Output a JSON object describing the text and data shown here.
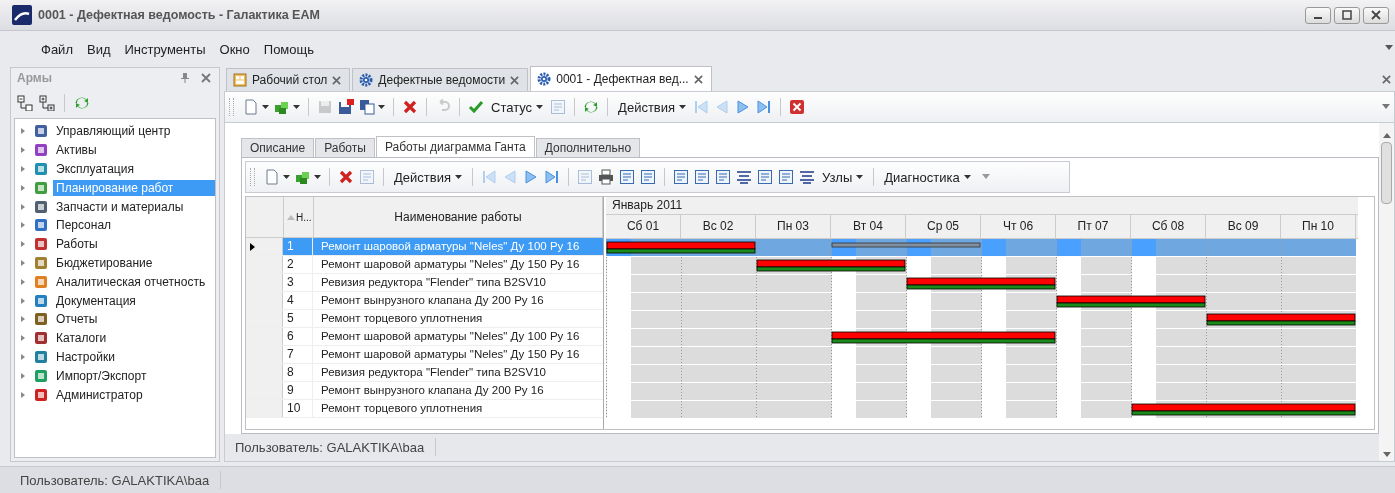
{
  "window": {
    "title": "0001 - Дефектная ведомость - Галактика EAM"
  },
  "menu": [
    "Файл",
    "Вид",
    "Инструменты",
    "Окно",
    "Помощь"
  ],
  "sidebar": {
    "title": "Армы",
    "items": [
      {
        "label": "Управляющий центр",
        "selected": false
      },
      {
        "label": "Активы",
        "selected": false
      },
      {
        "label": "Эксплуатация",
        "selected": false
      },
      {
        "label": "Планирование работ",
        "selected": true
      },
      {
        "label": "Запчасти и материалы",
        "selected": false
      },
      {
        "label": "Персонал",
        "selected": false
      },
      {
        "label": "Работы",
        "selected": false
      },
      {
        "label": "Бюджетирование",
        "selected": false
      },
      {
        "label": "Аналитическая отчетность",
        "selected": false
      },
      {
        "label": "Документация",
        "selected": false
      },
      {
        "label": "Отчеты",
        "selected": false
      },
      {
        "label": "Каталоги",
        "selected": false
      },
      {
        "label": "Настройки",
        "selected": false
      },
      {
        "label": "Импорт/Экспорт",
        "selected": false
      },
      {
        "label": "Администратор",
        "selected": false
      }
    ]
  },
  "doc_tabs": [
    {
      "label": "Рабочий стол",
      "selected": false
    },
    {
      "label": "Дефектные ведомости",
      "selected": false
    },
    {
      "label": "0001 - Дефектная вед...",
      "selected": true
    }
  ],
  "toolbar": {
    "menus": [
      "Статус",
      "Действия"
    ]
  },
  "form_tabs": [
    {
      "label": "Описание",
      "selected": false
    },
    {
      "label": "Работы",
      "selected": false
    },
    {
      "label": "Работы диаграмма Ганта",
      "selected": true
    },
    {
      "label": "Дополнительно",
      "selected": false
    }
  ],
  "grid_toolbar": {
    "menus": [
      "Действия",
      "Узлы",
      "Диагностика"
    ]
  },
  "table": {
    "columns": [
      "Н...",
      "Наименование работы"
    ],
    "rows": [
      {
        "number": "1",
        "name": "Ремонт шаровой арматуры \"Neles\" Ду 100 Ру 16",
        "selected": true
      },
      {
        "number": "2",
        "name": "Ремонт шаровой арматуры \"Neles\" Ду 150 Ру 16",
        "selected": false
      },
      {
        "number": "3",
        "name": "Ревизия редуктора \"Flender\" типа B2SV10",
        "selected": false
      },
      {
        "number": "4",
        "name": "Ремонт вынрузного клапана Ду 200 Ру 16",
        "selected": false
      },
      {
        "number": "5",
        "name": "Ремонт торцевого уплотнения",
        "selected": false
      },
      {
        "number": "6",
        "name": "Ремонт шаровой арматуры \"Neles\" Ду 100 Ру 16",
        "selected": false
      },
      {
        "number": "7",
        "name": "Ремонт шаровой арматуры \"Neles\" Ду 150 Ру 16",
        "selected": false
      },
      {
        "number": "8",
        "name": "Ревизия редуктора \"Flender\" типа B2SV10",
        "selected": false
      },
      {
        "number": "9",
        "name": "Ремонт вынрузного клапана Ду 200 Ру 16",
        "selected": false
      },
      {
        "number": "10",
        "name": "Ремонт торцевого уплотнения",
        "selected": false
      }
    ]
  },
  "gantt": {
    "month": "Январь 2011",
    "days": [
      "Сб 01",
      "Вс 02",
      "Пн 03",
      "Вт 04",
      "Ср 05",
      "Чт 06",
      "Пт 07",
      "Сб 08",
      "Вс 09",
      "Пн 10"
    ]
  },
  "status": {
    "inner": "Пользователь: GALAKTIKA\\baa",
    "outer": "Пользователь: GALAKTIKA\\baa"
  }
}
